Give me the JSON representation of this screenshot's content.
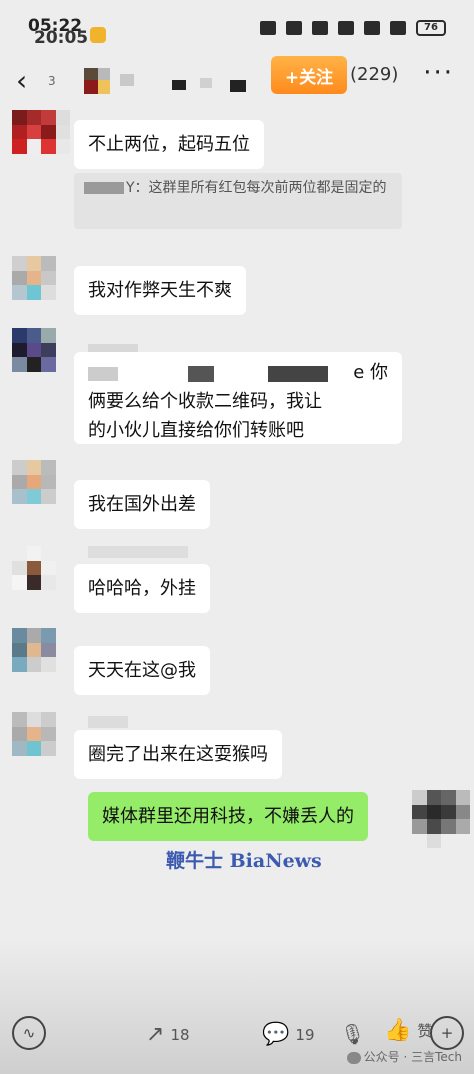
{
  "status_bar": {
    "time_primary": "05:22",
    "time_secondary": "20:05",
    "battery": "76"
  },
  "nav": {
    "back_count": "3",
    "follow_label": "+关注",
    "member_count": "(229)",
    "more_label": "···"
  },
  "messages": [
    {
      "text": "不止两位，起码五位"
    },
    {
      "quote_text": "Y：这群里所有红包每次前两位都是固定的"
    },
    {
      "text": "我对作弊天生不爽"
    },
    {
      "text_line1": "e 你",
      "text_line2": "俩要么给个收款二维码，我让",
      "text_line3": "的小伙儿直接给你们转账吧"
    },
    {
      "text": "我在国外出差"
    },
    {
      "text": "哈哈哈，外挂"
    },
    {
      "text": "天天在这@我"
    },
    {
      "text": "圈完了出来在这耍猴吗"
    },
    {
      "text": "媒体群里还用科技，不嫌丢人的"
    }
  ],
  "watermark": "鞭牛士 BiaNews",
  "bottom_bar": {
    "share_count": "18",
    "comment_count": "19",
    "like_label": "赞"
  },
  "credit": "公众号 · 三言Tech",
  "colors": {
    "follow_orange": "#ff8a1c",
    "self_bubble_green": "#95ec69",
    "watermark_blue": "#3b5ab0"
  }
}
